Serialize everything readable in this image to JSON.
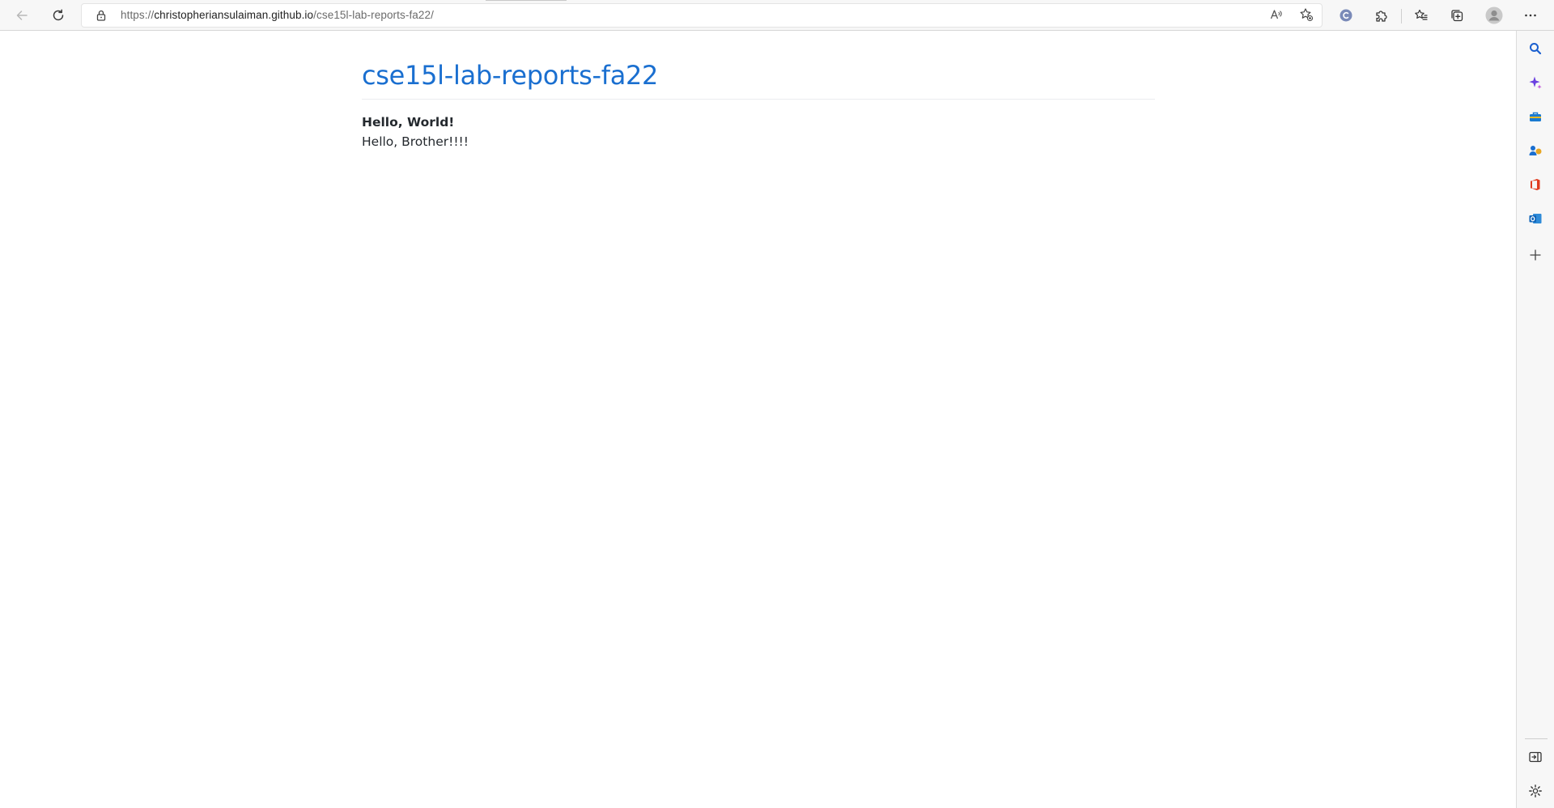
{
  "browser": {
    "url_scheme": "https://",
    "url_host": "christopheriansulaiman.github.io",
    "url_path": "/cse15l-lab-reports-fa22/"
  },
  "toolbar_icons": [
    "back-icon",
    "refresh-icon",
    "lock-icon",
    "read-aloud-icon",
    "add-favorite-icon",
    "profile-extension-icon",
    "extensions-icon",
    "favorites-icon",
    "collections-icon",
    "avatar-icon",
    "more-icon"
  ],
  "sidebar_icons": [
    "search-icon",
    "copilot-icon",
    "tools-icon",
    "games-icon",
    "office-icon",
    "outlook-icon",
    "add-icon",
    "hide-sidebar-icon",
    "settings-icon"
  ],
  "colors": {
    "title_link": "#1a6fd0",
    "text": "#24292e",
    "toolbar_bg": "#f7f7f7"
  },
  "page": {
    "site_title": "cse15l-lab-reports-fa22",
    "heading": "Hello, World!",
    "body_text": "Hello, Brother!!!!"
  }
}
